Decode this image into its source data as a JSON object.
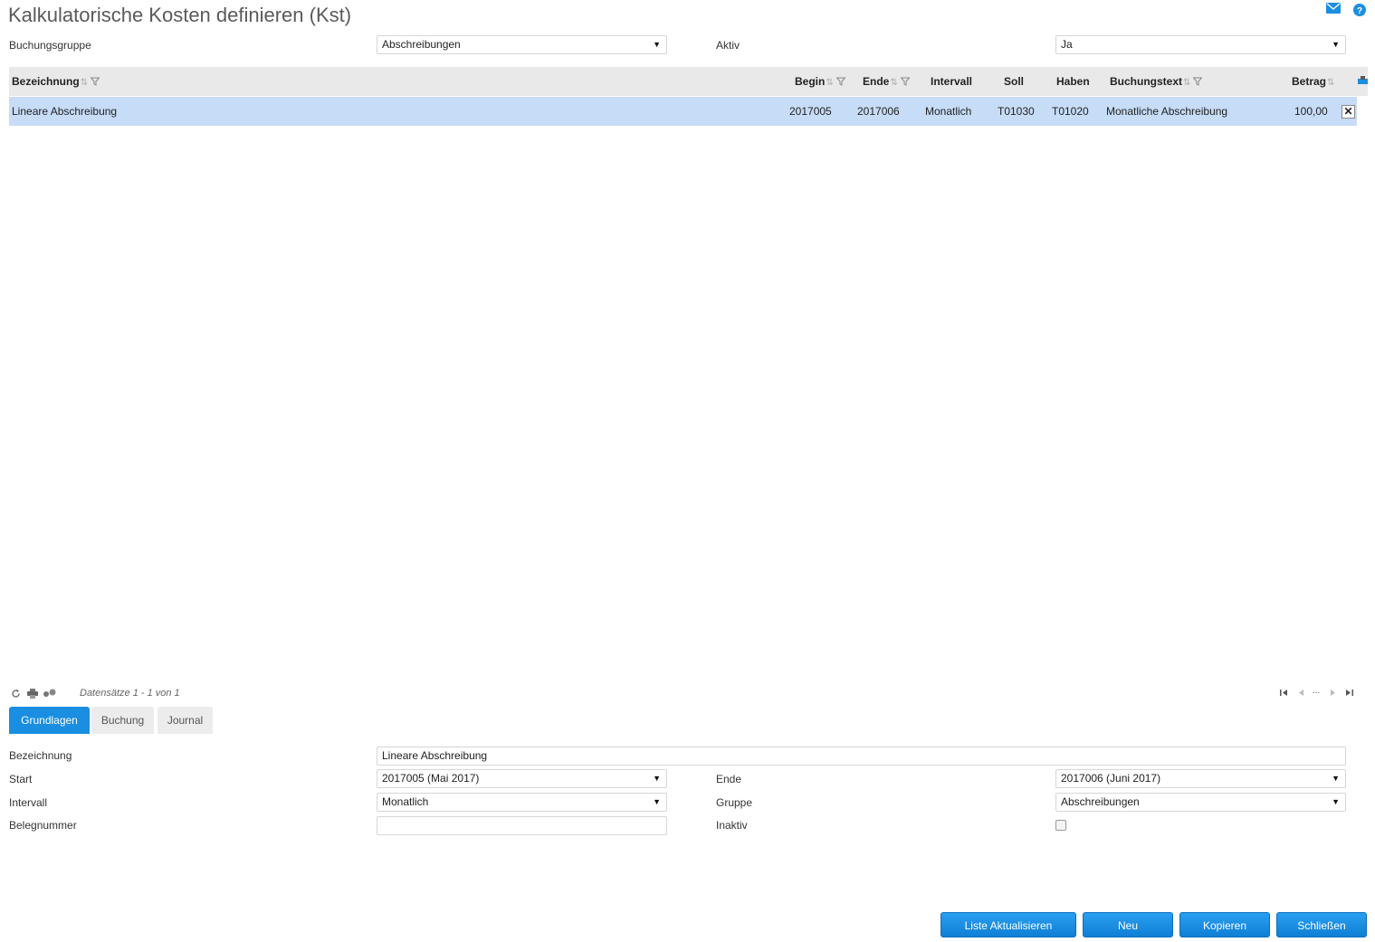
{
  "page": {
    "title": "Kalkulatorische Kosten definieren (Kst)"
  },
  "filters": {
    "buchungsgruppe_label": "Buchungsgruppe",
    "buchungsgruppe_value": "Abschreibungen",
    "aktiv_label": "Aktiv",
    "aktiv_value": "Ja"
  },
  "grid": {
    "columns": {
      "bezeichnung": "Bezeichnung",
      "begin": "Begin",
      "ende": "Ende",
      "intervall": "Intervall",
      "soll": "Soll",
      "haben": "Haben",
      "buchungstext": "Buchungstext",
      "betrag": "Betrag"
    },
    "rows": [
      {
        "bezeichnung": "Lineare Abschreibung",
        "begin": "2017005",
        "ende": "2017006",
        "intervall": "Monatlich",
        "soll": "T01030",
        "haben": "T01020",
        "buchungstext": "Monatliche Abschreibung",
        "betrag": "100,00",
        "delete": "✕"
      }
    ],
    "records_text": "Datensätze 1 - 1 von 1",
    "pager_ellipsis": "..."
  },
  "tabs": [
    "Grundlagen",
    "Buchung",
    "Journal"
  ],
  "form": {
    "bezeichnung_label": "Bezeichnung",
    "bezeichnung_value": "Lineare Abschreibung",
    "start_label": "Start",
    "start_value": "2017005 (Mai 2017)",
    "ende_label": "Ende",
    "ende_value": "2017006 (Juni 2017)",
    "intervall_label": "Intervall",
    "intervall_value": "Monatlich",
    "gruppe_label": "Gruppe",
    "gruppe_value": "Abschreibungen",
    "belegnummer_label": "Belegnummer",
    "belegnummer_value": "",
    "inaktiv_label": "Inaktiv",
    "inaktiv_checked": false
  },
  "buttons": {
    "refresh": "Liste Aktualisieren",
    "new": "Neu",
    "copy": "Kopieren",
    "close": "Schließen"
  },
  "colors": {
    "accent": "#1a8ee0",
    "selected_row": "#c6dcf7",
    "header_bg": "#e9e9e9"
  },
  "icons": {
    "mail": "mail-icon",
    "help": "help-icon",
    "refresh": "refresh-icon",
    "print": "print-icon",
    "settings": "settings-icon",
    "column_chooser": "column-chooser-icon"
  }
}
